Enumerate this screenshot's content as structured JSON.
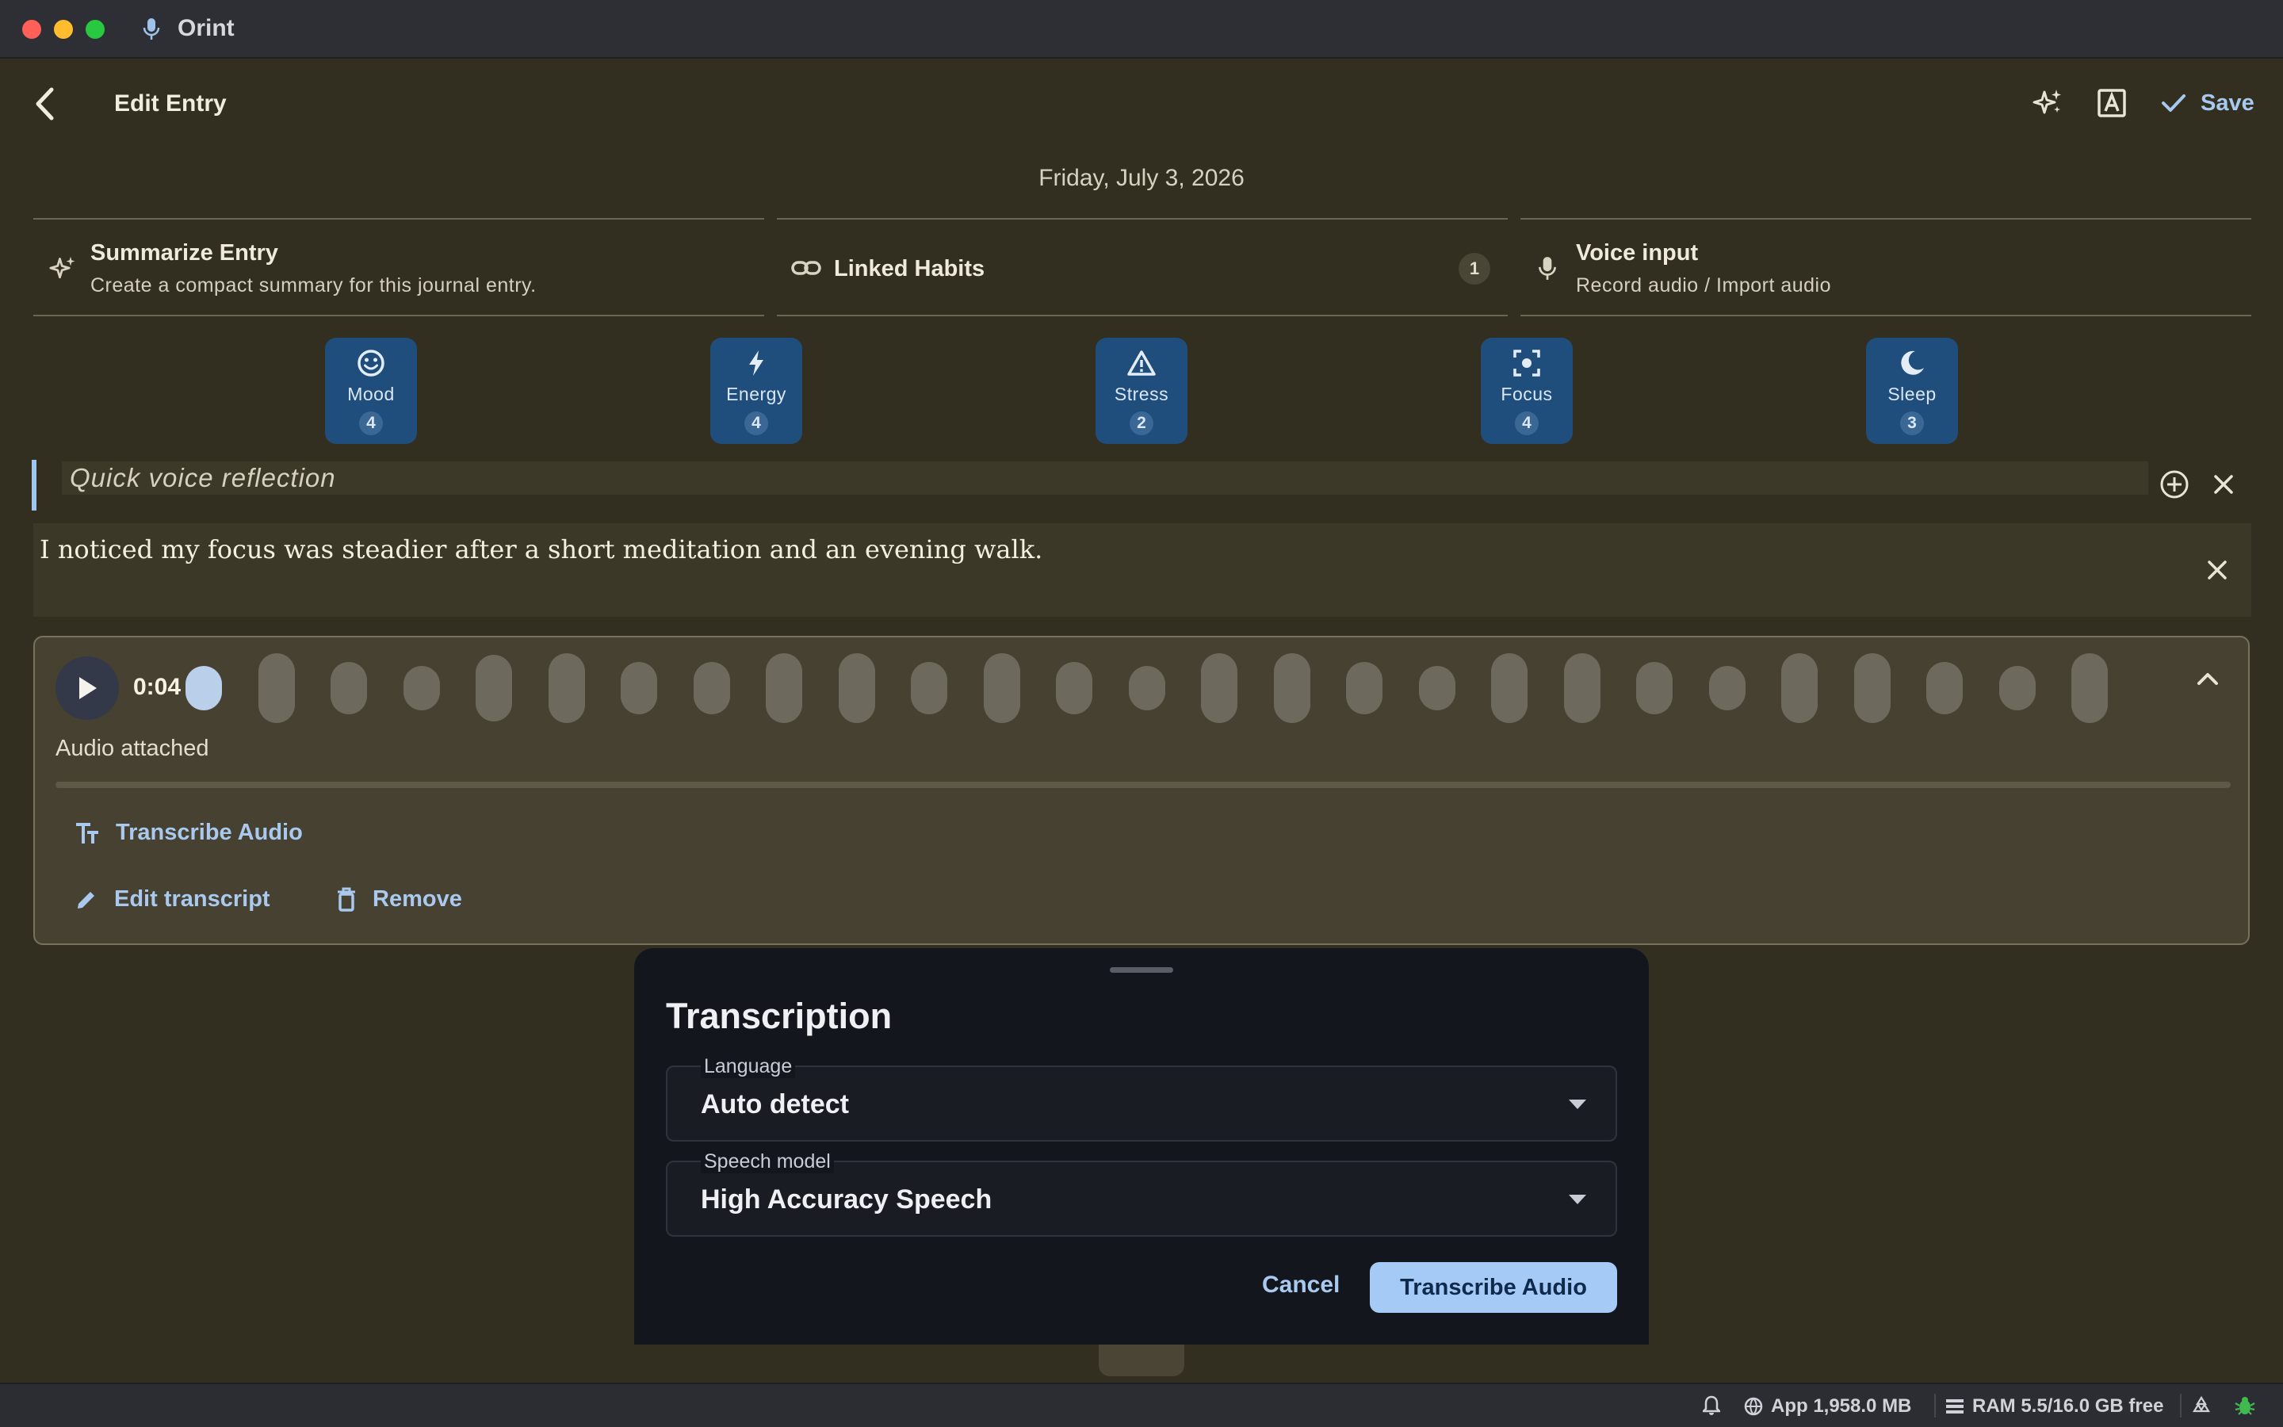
{
  "window": {
    "app_name": "Orint"
  },
  "header": {
    "title": "Edit Entry",
    "save_label": "Save"
  },
  "entry": {
    "date": "Friday, July 3, 2026"
  },
  "cards": {
    "summarize": {
      "title": "Summarize Entry",
      "subtitle": "Create a compact summary for this journal entry."
    },
    "habits": {
      "title": "Linked Habits",
      "count": "1"
    },
    "voice": {
      "title": "Voice input",
      "subtitle": "Record audio / Import audio"
    }
  },
  "metrics": [
    {
      "label": "Mood",
      "value": "4",
      "icon": "smile-icon"
    },
    {
      "label": "Energy",
      "value": "4",
      "icon": "bolt-icon"
    },
    {
      "label": "Stress",
      "value": "2",
      "icon": "warning-icon"
    },
    {
      "label": "Focus",
      "value": "4",
      "icon": "focus-icon"
    },
    {
      "label": "Sleep",
      "value": "3",
      "icon": "moon-icon"
    }
  ],
  "title_field": {
    "value": "Quick voice reflection"
  },
  "body": {
    "text": "I noticed my focus was steadier after a short meditation and an evening walk."
  },
  "audio": {
    "time": "0:04",
    "status": "Audio attached",
    "progress": 0,
    "transcribe_label": "Transcribe Audio",
    "edit_label": "Edit transcript",
    "remove_label": "Remove"
  },
  "dialog": {
    "title": "Transcription",
    "language": {
      "label": "Language",
      "value": "Auto detect"
    },
    "model": {
      "label": "Speech model",
      "value": "High Accuracy Speech"
    },
    "cancel_label": "Cancel",
    "confirm_label": "Transcribe Audio"
  },
  "status_bar": {
    "app_memory": "App 1,958.0 MB",
    "ram": "RAM 5.5/16.0 GB free"
  },
  "colors": {
    "background": "#332f20",
    "accent": "#a6caf6",
    "metric_chip": "#1f4d7c",
    "sheet": "#13161c"
  }
}
